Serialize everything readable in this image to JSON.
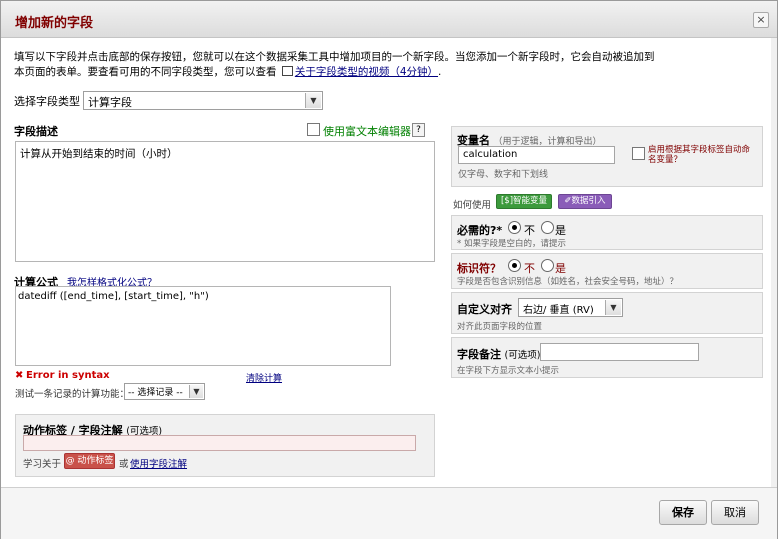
{
  "dialog": {
    "title": "增加新的字段",
    "close_glyph": "×"
  },
  "intro": {
    "line1": "填写以下字段并点击底部的保存按钮，您就可以在这个数据采集工具中增加项目的一个新字段。当您添加一个新字段时，它会自动被追加到",
    "line2_prefix": "本页面的表单。要查看可用的不同字段类型，您可以查看",
    "video_link": "关于字段类型的视频（4分钟）",
    "line2_suffix": "."
  },
  "field_type": {
    "label": "选择字段类型",
    "value": "计算字段"
  },
  "field_desc": {
    "label": "字段描述",
    "rich_text_label": "使用富文本编辑器",
    "help_glyph": "?",
    "value": "计算从开始到结束的时间（小时）"
  },
  "variable": {
    "label": "变量名",
    "hint": "（用于逻辑，计算和导出）",
    "value": "calculation",
    "note": "仅字母、数字和下划线",
    "auto_label": "启用根据其字段标签自动命名变量？"
  },
  "how_to_use": {
    "label": "如何使用",
    "smart_vars": "智能变量",
    "piping": "数据引入",
    "smart_glyph": "[$]",
    "piping_glyph": "✐"
  },
  "required": {
    "label": "必需的?*",
    "opt_no": "不",
    "opt_yes": "是",
    "note": "* 如果字段是空白的，请提示"
  },
  "identifier": {
    "label": "标识符？",
    "opt_no": "不",
    "opt_yes": "是",
    "note": "字段是否包含识别信息（如姓名，社会安全号码，地址）？"
  },
  "align": {
    "label": "自定义对齐",
    "value": "右边/ 垂直 (RV)",
    "note": "对齐此页面字段的位置"
  },
  "field_note": {
    "label": "字段备注",
    "optional": "(可选项)",
    "value": "",
    "note": "在字段下方显示文本小提示"
  },
  "formula": {
    "label": "计算公式",
    "help_link": "我怎样格式化公式？",
    "value": "datediff ([end_time], [start_time], \"h\")",
    "error_glyph": "✖",
    "error": "Error in syntax",
    "clear_link": "清除计算",
    "test_label": "测试一条记录的计算功能：",
    "test_select": "-- 选择记录 --"
  },
  "action_tags": {
    "label": "动作标签 / 字段注解",
    "optional": "(可选项)",
    "value": "",
    "learn_prefix": "学习关于",
    "tag_button": "@ 动作标签",
    "or": "或",
    "annotation_link": "使用字段注解"
  },
  "footer": {
    "save": "保存",
    "cancel": "取消"
  },
  "colors": {
    "title": "#800000",
    "link": "#000080",
    "rich_text": "#008000",
    "error": "#cc0000",
    "smart_btn": "#3c9a3c",
    "pipe_btn": "#8a5cb8",
    "tag_btn": "#c9524a"
  }
}
